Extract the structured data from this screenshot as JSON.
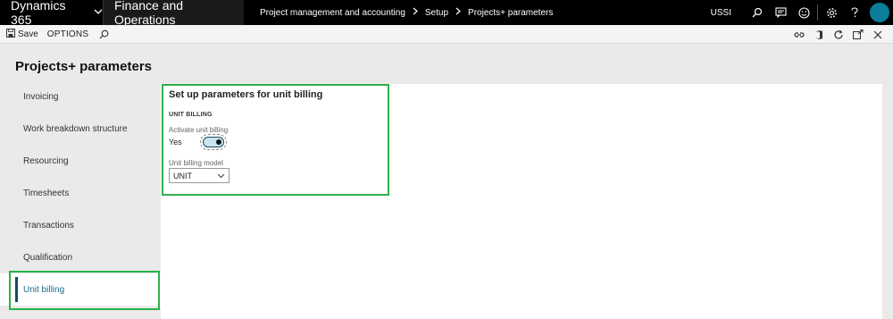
{
  "topbar": {
    "brand": "Dynamics 365",
    "app_name": "Finance and Operations",
    "breadcrumb": [
      "Project management and accounting",
      "Setup",
      "Projects+ parameters"
    ],
    "company": "USSI",
    "avatar_color": "#0a7e9b"
  },
  "actionbar": {
    "save_label": "Save",
    "options_label": "OPTIONS"
  },
  "page": {
    "title": "Projects+ parameters"
  },
  "tabs": [
    {
      "label": "Invoicing"
    },
    {
      "label": "Work breakdown structure"
    },
    {
      "label": "Resourcing"
    },
    {
      "label": "Timesheets"
    },
    {
      "label": "Transactions"
    },
    {
      "label": "Qualification"
    },
    {
      "label": "Unit billing",
      "active": true
    }
  ],
  "unit_billing": {
    "section_title": "Set up parameters for unit billing",
    "group_title": "UNIT BILLING",
    "activate_label": "Activate unit billing",
    "activate_value": "Yes",
    "activate_on": true,
    "model_label": "Unit billing model",
    "model_value": "UNIT"
  },
  "colors": {
    "highlight": "#2db24a",
    "accent": "#1d6a88"
  }
}
